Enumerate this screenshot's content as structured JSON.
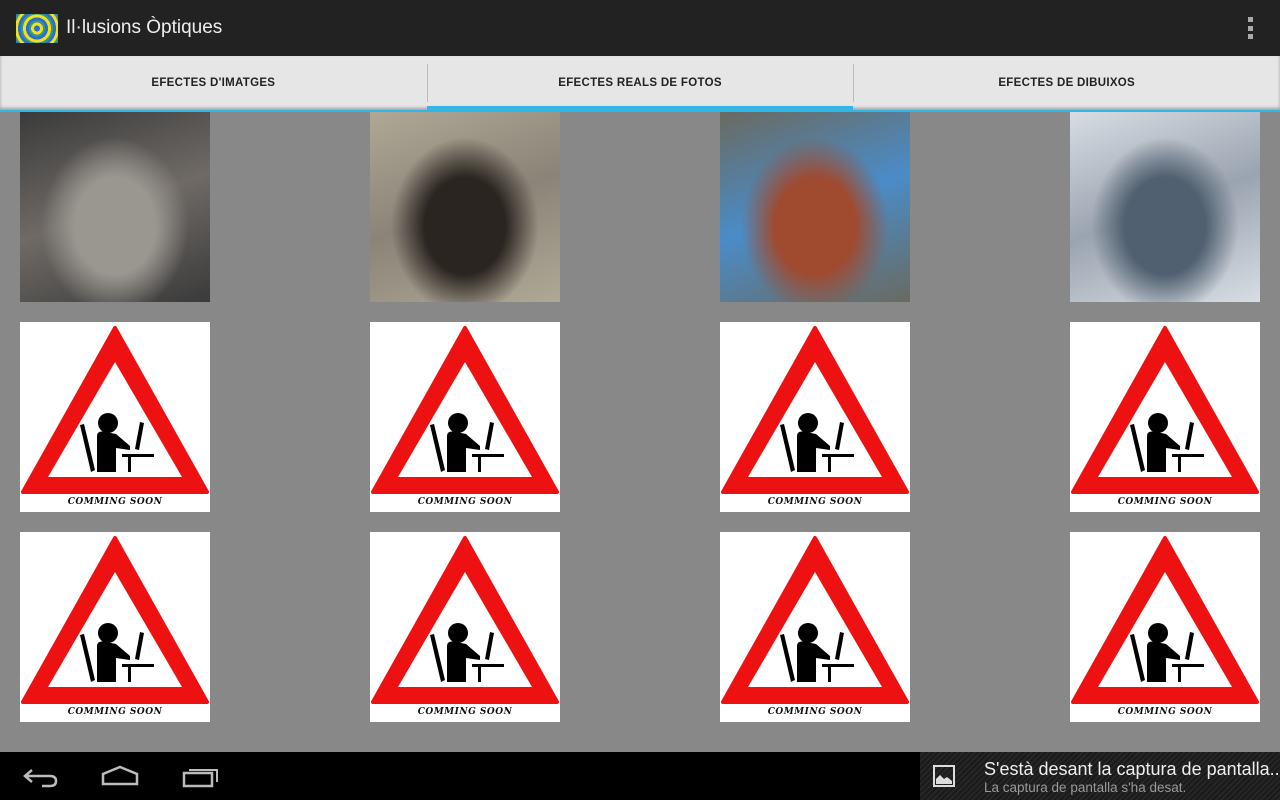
{
  "app": {
    "title": "Il·lusions Òptiques",
    "icon": "op-art-spiral-icon"
  },
  "tabs": [
    {
      "label": "EFECTES D'IMATGES",
      "active": false
    },
    {
      "label": "EFECTES REALS DE FOTOS",
      "active": true
    },
    {
      "label": "EFECTES DE DIBUIXOS",
      "active": false
    }
  ],
  "tiles": [
    {
      "type": "photo",
      "name": "street-art-pit-photo",
      "colors": [
        "#6f6a66",
        "#9a9690",
        "#3a3a3a"
      ]
    },
    {
      "type": "photo",
      "name": "street-art-hole-photo",
      "colors": [
        "#8a8478",
        "#2a2520",
        "#b0a896"
      ]
    },
    {
      "type": "photo",
      "name": "street-art-pool-photo",
      "colors": [
        "#4a8cc8",
        "#a04a30",
        "#6a6a60"
      ]
    },
    {
      "type": "photo",
      "name": "street-art-waterfall-photo",
      "colors": [
        "#9aa4b0",
        "#506070",
        "#d8dde4"
      ]
    },
    {
      "type": "soon",
      "label": "COMMING SOON"
    },
    {
      "type": "soon",
      "label": "COMMING SOON"
    },
    {
      "type": "soon",
      "label": "COMMING SOON"
    },
    {
      "type": "soon",
      "label": "COMMING SOON"
    },
    {
      "type": "soon",
      "label": "COMMING SOON"
    },
    {
      "type": "soon",
      "label": "COMMING SOON"
    },
    {
      "type": "soon",
      "label": "COMMING SOON"
    },
    {
      "type": "soon",
      "label": "COMMING SOON"
    }
  ],
  "notification": {
    "icon": "image-icon",
    "title": "S'està desant la captura de pantalla...",
    "subtitle": "La captura de pantalla s'ha desat."
  },
  "colors": {
    "accent": "#33b5e5",
    "actionbar": "#222222",
    "background": "#888888",
    "sign_red": "#ee1111"
  }
}
